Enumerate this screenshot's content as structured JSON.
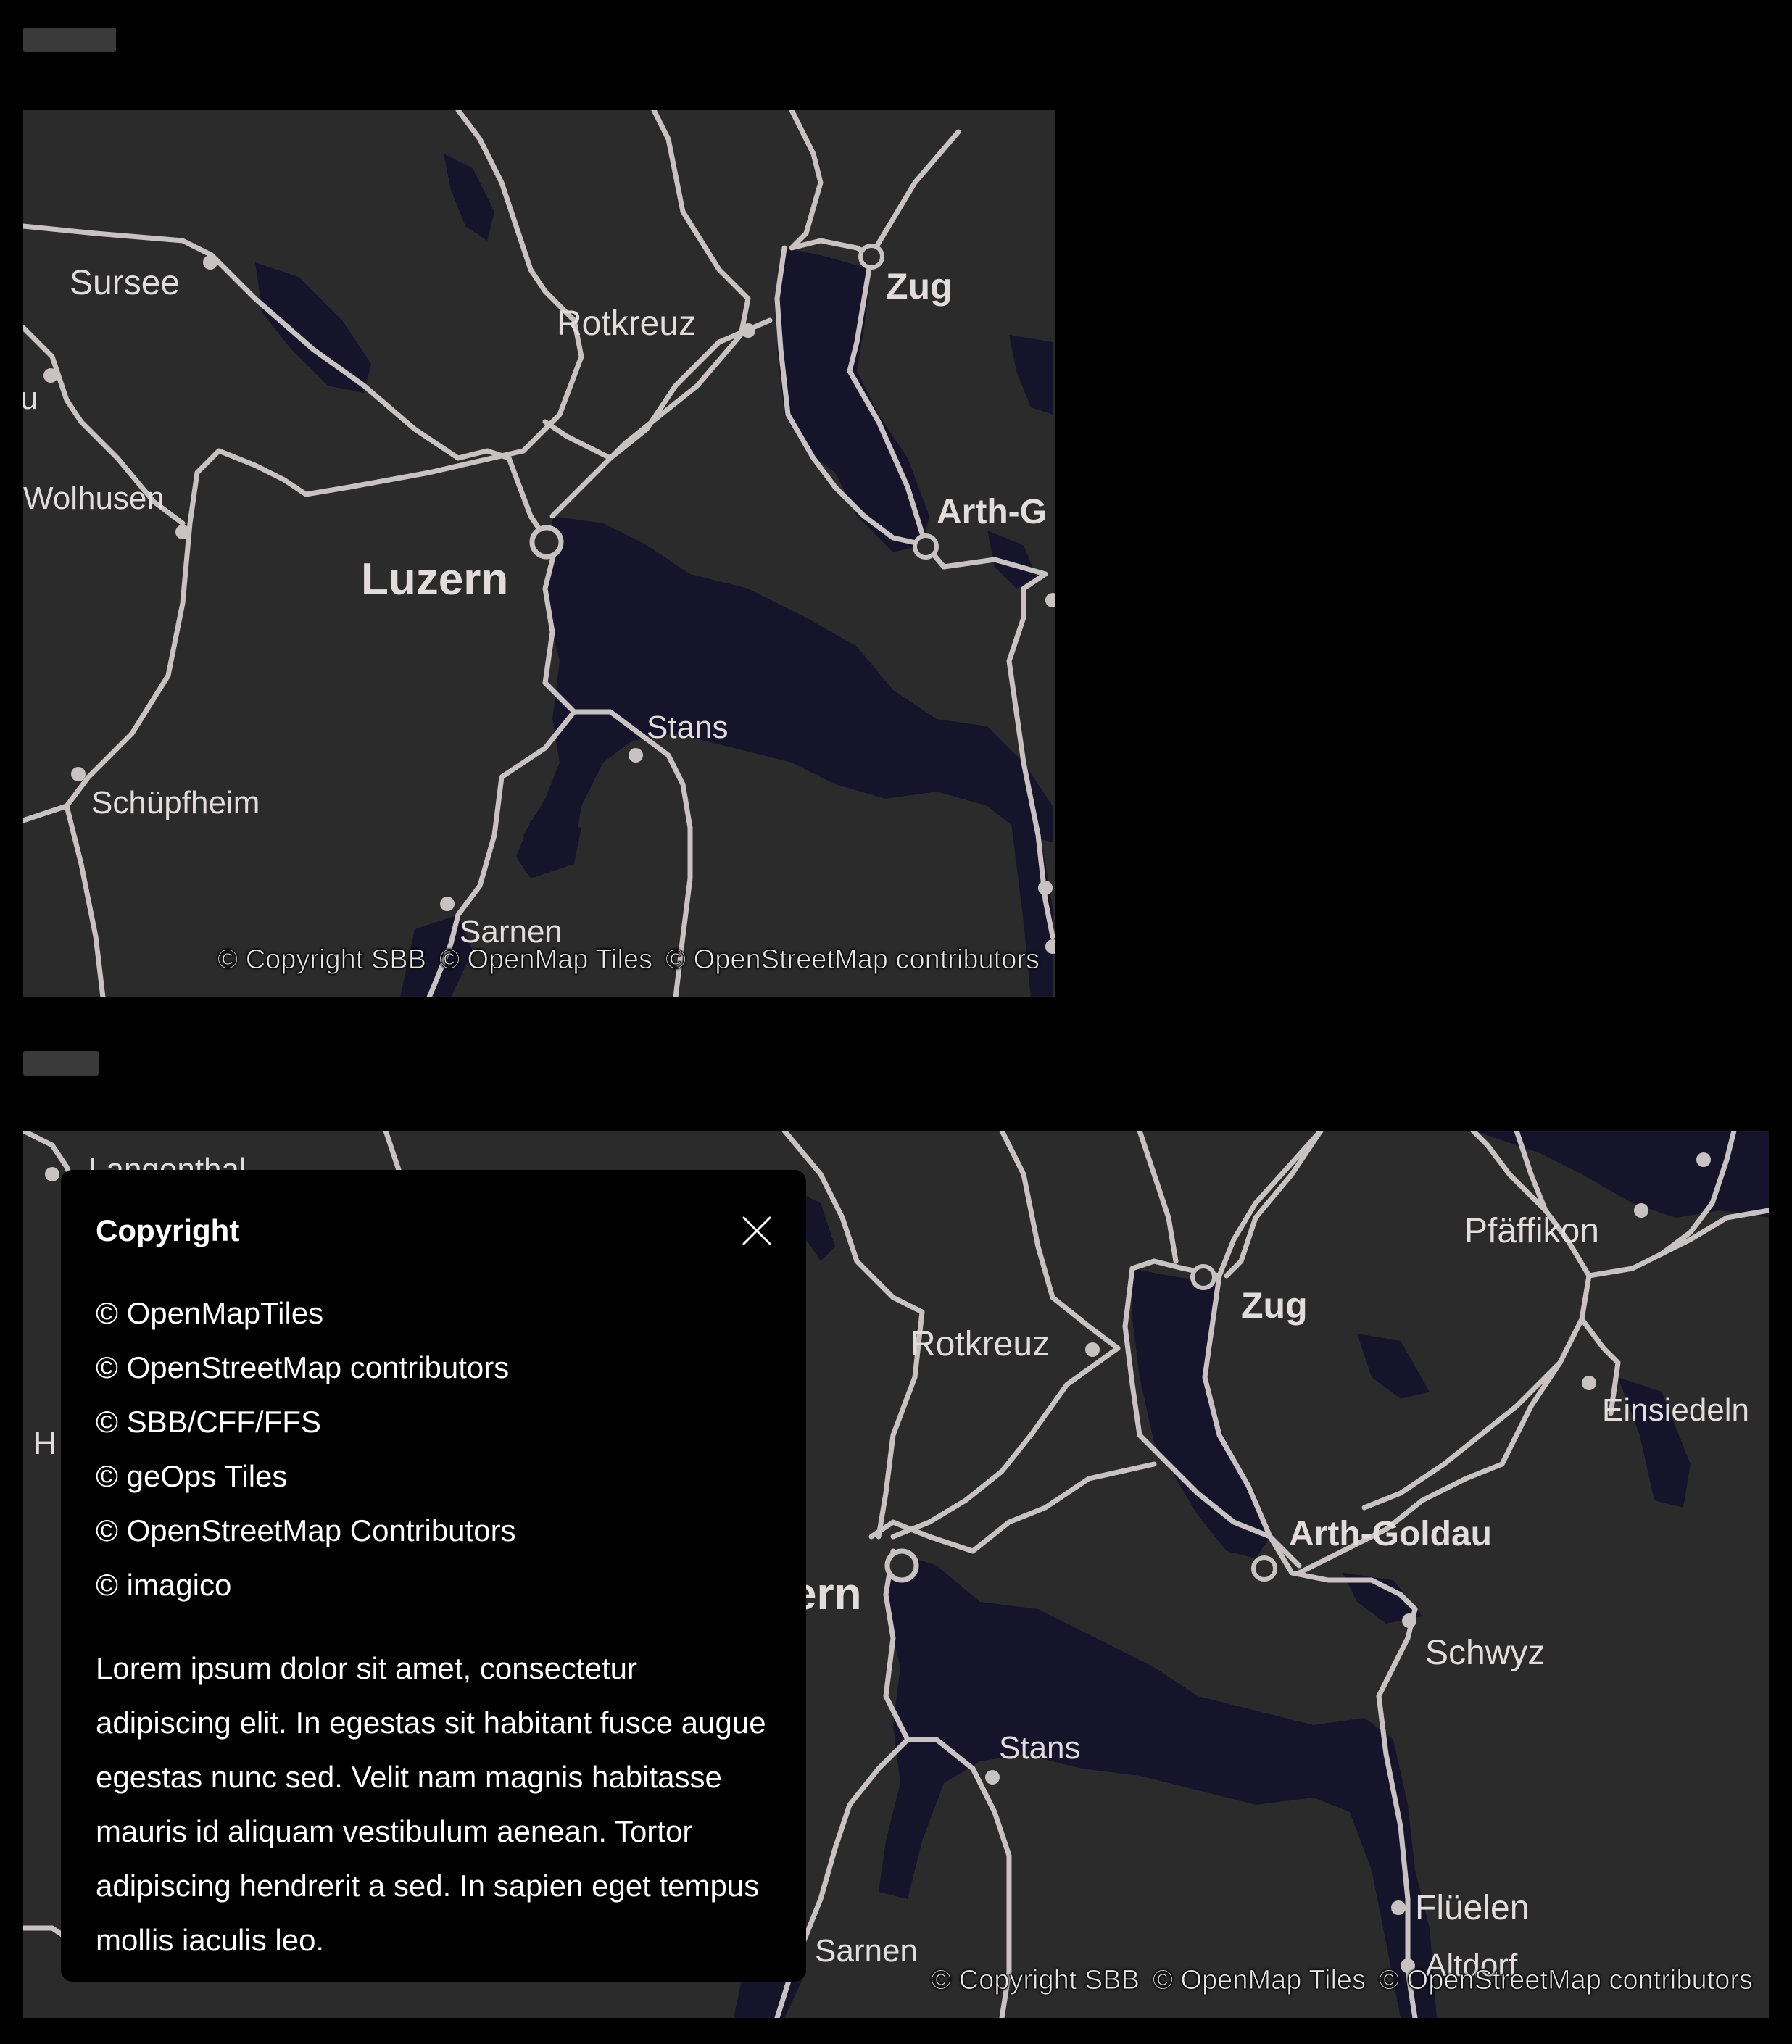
{
  "maps": [
    {
      "id": "map-small",
      "cities": [
        {
          "name": "Sursee",
          "bold": false
        },
        {
          "name": "Rotkreuz",
          "bold": false
        },
        {
          "name": "Zug",
          "bold": true
        },
        {
          "name": "Wolhusen",
          "bold": false
        },
        {
          "name": "Arth-G",
          "bold": true
        },
        {
          "name": "Luzern",
          "bold": true
        },
        {
          "name": "Stans",
          "bold": false
        },
        {
          "name": "Schüpfheim",
          "bold": false
        },
        {
          "name": "Sarnen",
          "bold": false
        },
        {
          "name": "u",
          "bold": false
        }
      ],
      "attribution": [
        "© Copyright SBB",
        "© OpenMap Tiles",
        "© OpenStreetMap contributors"
      ]
    },
    {
      "id": "map-large",
      "cities": [
        {
          "name": "Langenthal",
          "bold": false
        },
        {
          "name": "Pfäffikon",
          "bold": false
        },
        {
          "name": "Rotkreuz",
          "bold": false
        },
        {
          "name": "Zug",
          "bold": true
        },
        {
          "name": "Einsiedeln",
          "bold": false
        },
        {
          "name": "H",
          "bold": false
        },
        {
          "name": "Arth-Goldau",
          "bold": true
        },
        {
          "name": "ern",
          "bold": true
        },
        {
          "name": "Schwyz",
          "bold": false
        },
        {
          "name": "Stans",
          "bold": false
        },
        {
          "name": "Flüelen",
          "bold": false
        },
        {
          "name": "Sarnen",
          "bold": false
        },
        {
          "name": "Altdorf",
          "bold": false
        }
      ],
      "attribution": [
        "© Copyright SBB",
        "© OpenMap Tiles",
        "© OpenStreetMap contributors"
      ]
    }
  ],
  "copyright_popup": {
    "title": "Copyright",
    "close_icon": "close-icon",
    "items": [
      "© OpenMapTiles",
      "© OpenStreetMap contributors",
      "© SBB/CFF/FFS",
      "© geOps Tiles",
      "© OpenStreetMap Contributors",
      "© imagico"
    ],
    "body": "Lorem ipsum dolor sit amet, consectetur adipiscing elit. In egestas sit habitant fusce augue egestas nunc sed. Velit nam magnis habitasse mauris id aliquam vestibulum aenean. Tortor adipiscing hendrerit a sed. In sapien eget tempus mollis iaculis leo."
  },
  "colors": {
    "map_background": "#2b2b2c",
    "water": "#15142a",
    "rail": "#c9c2c2",
    "label": "#e2dcdc"
  }
}
